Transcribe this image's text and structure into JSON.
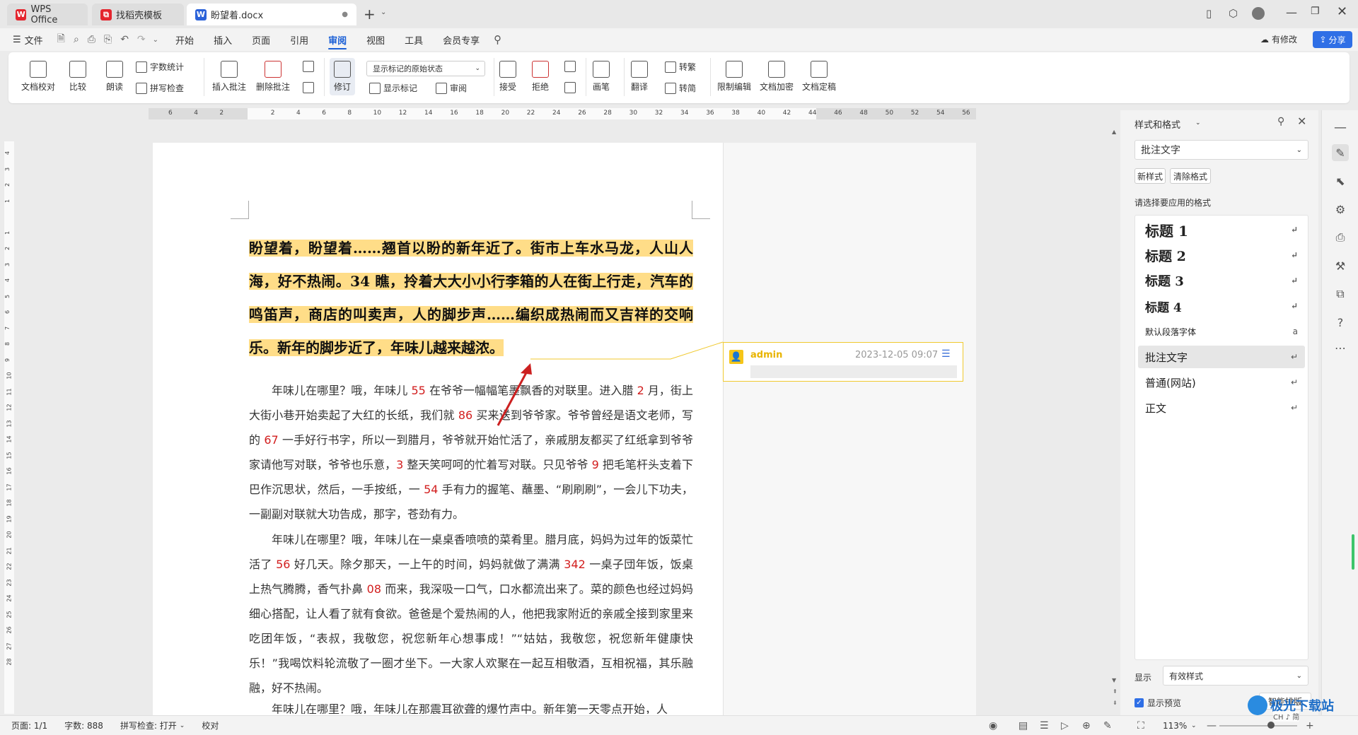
{
  "tabs": [
    {
      "label": "WPS Office",
      "icon": "wps-logo-icon"
    },
    {
      "label": "找稻壳模板",
      "icon": "docer-icon"
    },
    {
      "label": "盼望着.docx",
      "icon": "word-doc-icon"
    }
  ],
  "window": {
    "new_tab": "+"
  },
  "menubar": {
    "file": "文件",
    "items": [
      "开始",
      "插入",
      "页面",
      "引用",
      "审阅",
      "视图",
      "工具",
      "会员专享"
    ],
    "selected": "审阅",
    "changes": "有修改",
    "share": "分享"
  },
  "ribbon": {
    "proofread": "文档校对",
    "compare": "比较",
    "read_aloud": "朗读",
    "word_count": "字数统计",
    "spell_check": "拼写检查",
    "insert_comment": "插入批注",
    "delete_comment": "删除批注",
    "track": "修订",
    "display_dropdown": "显示标记的原始状态",
    "show_markup": "显示标记",
    "review": "审阅",
    "accept": "接受",
    "reject": "拒绝",
    "ink": "画笔",
    "translate": "翻译",
    "trad": "转繁",
    "simp": "转简",
    "restrict": "限制编辑",
    "encrypt": "文档加密",
    "finalize": "文档定稿"
  },
  "ruler_ticks": [
    "6",
    "4",
    "2",
    "",
    "2",
    "4",
    "6",
    "8",
    "10",
    "12",
    "14",
    "16",
    "18",
    "20",
    "22",
    "24",
    "26",
    "28",
    "30",
    "32",
    "34",
    "36",
    "38",
    "40",
    "42",
    "44",
    "46",
    "48",
    "50",
    "52",
    "54",
    "56"
  ],
  "vruler_ticks": [
    "4",
    "3",
    "2",
    "1",
    "",
    "1",
    "2",
    "3",
    "4",
    "5",
    "6",
    "7",
    "8",
    "9",
    "10",
    "11",
    "12",
    "13",
    "14",
    "15",
    "16",
    "17",
    "18",
    "19",
    "20",
    "21",
    "22",
    "23",
    "24",
    "25",
    "26",
    "27",
    "28"
  ],
  "document": {
    "bold_para": "盼望着，盼望着……翘首以盼的新年近了。街市上车水马龙，人山人海，好不热闹。34 瞧，拎着大大小小行李箱的人在街上行走，汽车的鸣笛声，商店的叫卖声，人的脚步声……编织成热闹而又吉祥的交响乐。新年的脚步近了，年味儿越来越浓。",
    "p1": [
      {
        "t": "年味儿在哪里？哦，年味儿 "
      },
      {
        "t": "55",
        "r": 1
      },
      {
        "t": " 在爷爷一幅幅笔墨飘香的对联里。进入腊 "
      },
      {
        "t": "2",
        "r": 1
      },
      {
        "t": " 月，街上大街小巷开始卖起了大红的长纸，我们就 "
      },
      {
        "t": "86",
        "r": 1
      },
      {
        "t": " 买来送到爷爷家。爷爷曾经是语文老师，写的 "
      },
      {
        "t": "67",
        "r": 1
      },
      {
        "t": " 一手好行书字，所以一到腊月，爷爷就开始忙活了，亲戚朋友都买了红纸拿到爷爷家请他写对联，爷爷也乐意，"
      },
      {
        "t": "3",
        "r": 1
      },
      {
        "t": " 整天笑呵呵的忙着写对联。只见爷爷 "
      },
      {
        "t": "9",
        "r": 1
      },
      {
        "t": " 把毛笔杆头支着下巴作沉思状，然后，一手按纸，一 "
      },
      {
        "t": "54",
        "r": 1
      },
      {
        "t": " 手有力的握笔、蘸墨、“刷刷刷”，一会儿下功夫，一副副对联就大功告成，那字，苍劲有力。"
      }
    ],
    "p2": [
      {
        "t": "年味儿在哪里？哦，年味儿在一桌桌香喷喷的菜肴里。腊月底，妈妈为过年的饭菜忙活了 "
      },
      {
        "t": "56",
        "r": 1
      },
      {
        "t": " 好几天。除夕那天，一上午的时间，妈妈就做了满满 "
      },
      {
        "t": "342",
        "r": 1
      },
      {
        "t": " 一桌子団年饭，饭桌上热气腾腾，香气扑鼻 "
      },
      {
        "t": "08",
        "r": 1
      },
      {
        "t": " 而来，我深吸一口气，口水都流出来了。菜的颜色也经过妈妈细心搭配，让人看了就有食欲。爸爸是个爱热闹的人，他把我家附近的亲戚全接到家里来吃团年饭，“表叔，我敬您，祝您新年心想事成！”“姑姑，我敬您，祝您新年健康快乐！”我喝饮料轮流敬了一圈才坐下。一大家人欢聚在一起互相敬酒，互相祝福，其乐融融，好不热闹。"
      }
    ],
    "p3": "年味儿在哪里？哦，年味儿在那震耳欲聋的爆竹声中。新年第一天零点开始，人"
  },
  "comment": {
    "author": "admin",
    "time": "2023-12-05 09:07"
  },
  "side_panel": {
    "title": "样式和格式",
    "current": "批注文字",
    "new_style": "新样式",
    "clear_format": "清除格式",
    "prompt": "请选择要应用的格式",
    "styles": [
      "标题 1",
      "标题 2",
      "标题 3",
      "标题 4",
      "默认段落字体",
      "批注文字",
      "普通(网站)",
      "正文"
    ],
    "selected_style": "批注文字",
    "show_label": "显示",
    "show_value": "有效样式",
    "preview_label": "显示预览",
    "smart_layout": "智能排版"
  },
  "statusbar": {
    "page": "页面: 1/1",
    "words": "字数: 888",
    "spell": "拼写检查: 打开",
    "proof": "校对",
    "zoom": "113%"
  },
  "watermark": {
    "text": "极光下载站",
    "sub": "CH ♪ 简"
  }
}
